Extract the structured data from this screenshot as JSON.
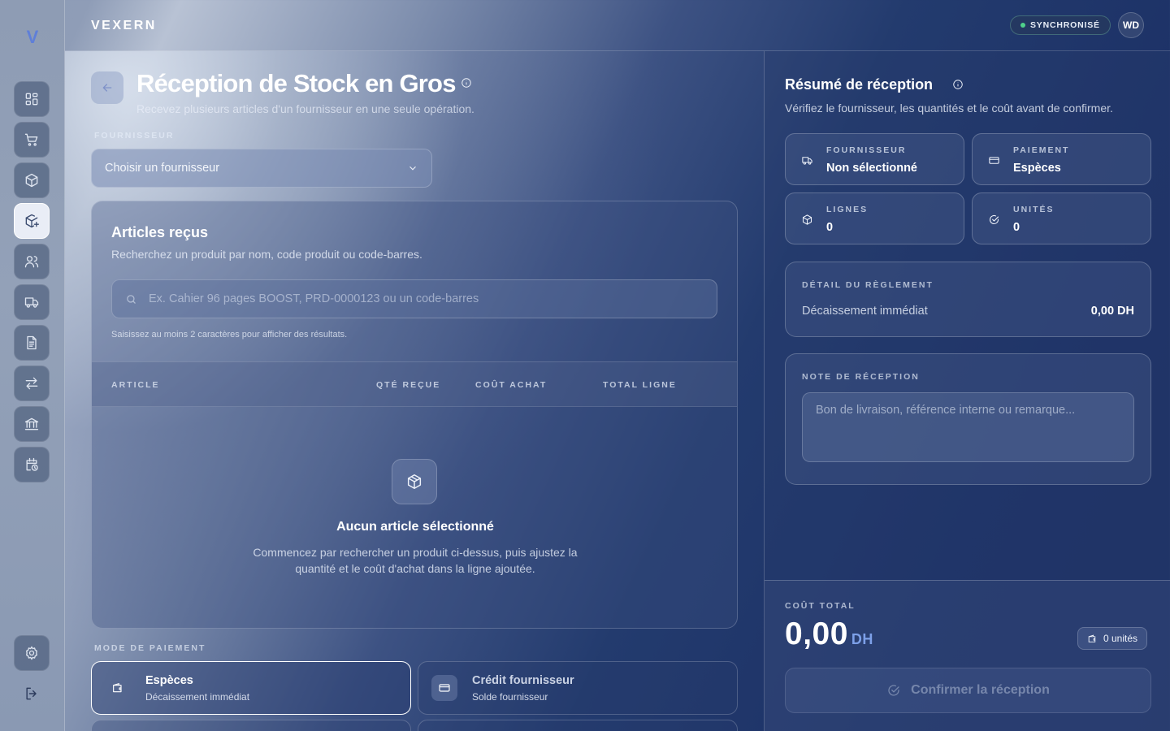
{
  "app": {
    "logo": "V",
    "brand": "VEXERN",
    "sync_status": "SYNCHRONISÉ",
    "user_initials": "WD"
  },
  "sidebar": {
    "items": [
      {
        "icon": "dashboard-icon"
      },
      {
        "icon": "cart-icon"
      },
      {
        "icon": "package-icon"
      },
      {
        "icon": "package-plus-icon",
        "active": true
      },
      {
        "icon": "users-icon"
      },
      {
        "icon": "truck-icon"
      },
      {
        "icon": "document-icon"
      },
      {
        "icon": "transfer-icon"
      },
      {
        "icon": "bank-icon"
      },
      {
        "icon": "calendar-clock-icon"
      }
    ],
    "settings_icon": "gear-icon",
    "logout_icon": "logout-icon"
  },
  "page": {
    "title": "Réception de Stock en Gros",
    "subtitle": "Recevez plusieurs articles d'un fournisseur en une seule opération."
  },
  "supplier": {
    "label": "FOURNISSEUR",
    "placeholder": "Choisir un fournisseur"
  },
  "articles": {
    "title": "Articles reçus",
    "subtitle": "Recherchez un produit par nom, code produit ou code-barres.",
    "search_placeholder": "Ex. Cahier 96 pages BOOST, PRD-0000123 ou un code-barres",
    "hint": "Saisissez au moins 2 caractères pour afficher des résultats.",
    "columns": [
      "ARTICLE",
      "QTÉ REÇUE",
      "COÛT ACHAT",
      "TOTAL LIGNE"
    ],
    "empty_title": "Aucun article sélectionné",
    "empty_text": "Commencez par rechercher un produit ci-dessus, puis ajustez la quantité et le coût d'achat dans la ligne ajoutée."
  },
  "payment": {
    "label": "MODE DE PAIEMENT",
    "options": [
      {
        "title": "Espèces",
        "subtitle": "Décaissement immédiat",
        "selected": true
      },
      {
        "title": "Crédit fournisseur",
        "subtitle": "Solde fournisseur",
        "selected": false
      }
    ]
  },
  "summary": {
    "title": "Résumé de réception",
    "subtitle": "Vérifiez le fournisseur, les quantités et le coût avant de confirmer.",
    "tiles": [
      {
        "label": "FOURNISSEUR",
        "value": "Non sélectionné",
        "icon": "truck-icon"
      },
      {
        "label": "PAIEMENT",
        "value": "Espèces",
        "icon": "card-icon"
      },
      {
        "label": "LIGNES",
        "value": "0",
        "icon": "package-icon"
      },
      {
        "label": "UNITÉS",
        "value": "0",
        "icon": "check-circle-icon"
      }
    ],
    "settlement": {
      "label": "DÉTAIL DU RÈGLEMENT",
      "text": "Décaissement immédiat",
      "amount": "0,00 DH"
    },
    "note": {
      "label": "NOTE DE RÉCEPTION",
      "placeholder": "Bon de livraison, référence interne ou remarque..."
    },
    "total": {
      "label": "COÛT TOTAL",
      "value": "0,00",
      "currency": "DH",
      "units": "0 unités"
    },
    "confirm_label": "Confirmer la réception"
  }
}
